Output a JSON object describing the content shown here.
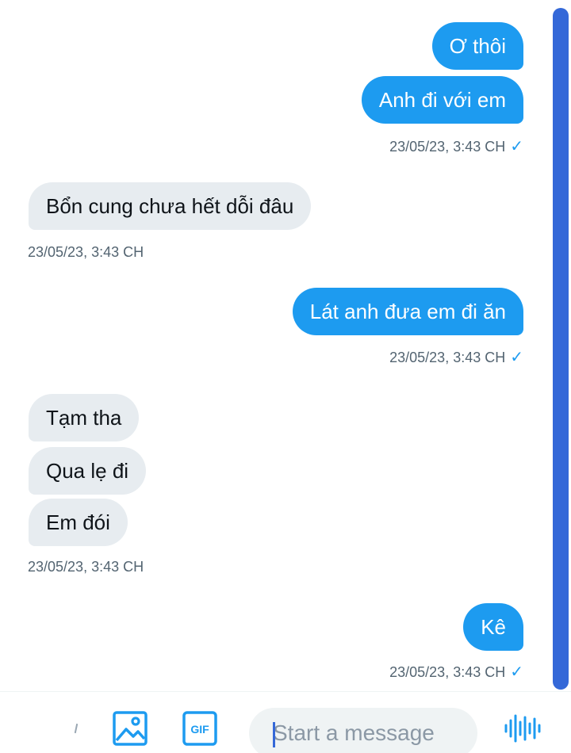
{
  "messages": [
    {
      "direction": "out",
      "text": "Ơ thôi"
    },
    {
      "direction": "out",
      "text": "Anh đi với em"
    },
    {
      "direction": "in",
      "text": "Bổn cung chưa hết dỗi đâu"
    },
    {
      "direction": "out",
      "text": "Lát anh đưa em đi ăn"
    },
    {
      "direction": "in",
      "text": "Tạm tha"
    },
    {
      "direction": "in",
      "text": "Qua lẹ đi"
    },
    {
      "direction": "in",
      "text": "Em đói"
    },
    {
      "direction": "out",
      "text": "Kê"
    }
  ],
  "timestamps": [
    {
      "text": "23/05/23, 3:43 CH",
      "direction": "out",
      "read_tick": "✓"
    },
    {
      "text": "23/05/23, 3:43 CH",
      "direction": "in"
    },
    {
      "text": "23/05/23, 3:43 CH",
      "direction": "out",
      "read_tick": "✓"
    },
    {
      "text": "23/05/23, 3:43 CH",
      "direction": "in"
    },
    {
      "text": "23/05/23, 3:43 CH",
      "direction": "out",
      "read_tick": "✓"
    }
  ],
  "composer": {
    "placeholder": "Start a message",
    "value": "",
    "icons": [
      "image-icon",
      "gif-icon",
      "voice-icon"
    ]
  },
  "colors": {
    "outgoing_bubble": "#1d9bf0",
    "incoming_bubble": "#e7ecf0",
    "scrollbar": "#3468d8",
    "accent": "#1d9bf0"
  }
}
